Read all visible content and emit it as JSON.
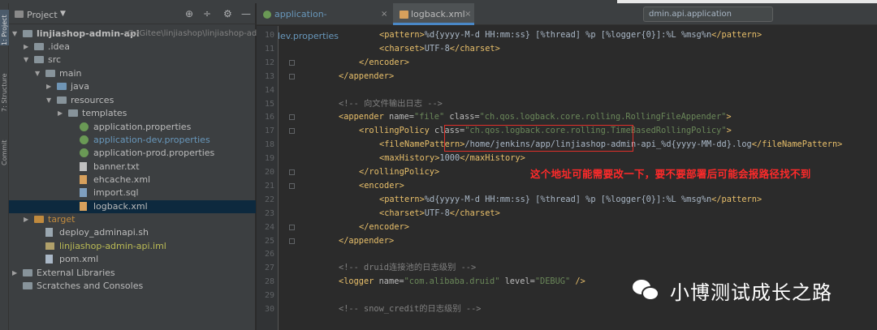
{
  "window": {
    "toolbar_hint": "dmin.api.application"
  },
  "sidebar_strip": {
    "project_label": "1: Project",
    "structure_label": "7: Structure",
    "commit_label": "Commit"
  },
  "project_panel": {
    "title": "Project",
    "tree": [
      {
        "label": "linjiashop-admin-api",
        "path": "G:\\Gitee\\linjiashop\\linjiashop-admi",
        "icon": "module-icon",
        "bold": true,
        "color": "#bbbbbb"
      },
      {
        "label": ".idea",
        "icon": "folder-icon",
        "color": "#bbbbbb"
      },
      {
        "label": "src",
        "icon": "folder-icon",
        "color": "#bbbbbb"
      },
      {
        "label": "main",
        "icon": "folder-icon",
        "color": "#bbbbbb"
      },
      {
        "label": "java",
        "icon": "source-folder-icon",
        "color": "#bbbbbb"
      },
      {
        "label": "resources",
        "icon": "resources-folder-icon",
        "color": "#bbbbbb"
      },
      {
        "label": "templates",
        "icon": "folder-icon",
        "color": "#bbbbbb"
      },
      {
        "label": "application.properties",
        "icon": "spring-properties-icon",
        "color": "#bbbbbb"
      },
      {
        "label": "application-dev.properties",
        "icon": "spring-properties-icon",
        "color": "#6897bb"
      },
      {
        "label": "application-prod.properties",
        "icon": "spring-properties-icon",
        "color": "#bbbbbb"
      },
      {
        "label": "banner.txt",
        "icon": "text-file-icon",
        "color": "#bbbbbb"
      },
      {
        "label": "ehcache.xml",
        "icon": "xml-file-icon",
        "color": "#bbbbbb"
      },
      {
        "label": "import.sql",
        "icon": "sql-file-icon",
        "color": "#bbbbbb"
      },
      {
        "label": "logback.xml",
        "icon": "xml-file-icon",
        "color": "#bbbbbb",
        "selected": true
      },
      {
        "label": "target",
        "icon": "excluded-folder-icon",
        "color": "#c08a3e"
      },
      {
        "label": "deploy_adminapi.sh",
        "icon": "shell-file-icon",
        "color": "#bbbbbb"
      },
      {
        "label": "linjiashop-admin-api.iml",
        "icon": "iml-file-icon",
        "color": "#bbbb55"
      },
      {
        "label": "pom.xml",
        "icon": "maven-icon",
        "color": "#bbbbbb"
      },
      {
        "label": "External Libraries",
        "icon": "library-icon",
        "color": "#bbbbbb"
      },
      {
        "label": "Scratches and Consoles",
        "icon": "scratch-icon",
        "color": "#bbbbbb"
      }
    ]
  },
  "tabs": [
    {
      "label": "application-dev.properties",
      "color": "#6897bb"
    },
    {
      "label": "logback.xml",
      "color": "#bbbbbb",
      "active": true
    }
  ],
  "code": {
    "line_numbers": [
      "10",
      "11",
      "12",
      "13",
      "14",
      "15",
      "16",
      "17",
      "18",
      "19",
      "20",
      "21",
      "22",
      "23",
      "24",
      "25",
      "26",
      "27",
      "28",
      "29",
      "30"
    ],
    "lines": [
      [
        [
          "t-tag",
          "<pattern>"
        ],
        [
          "t-txt",
          "%d{yyyy-M-d HH:mm:ss} [%thread] %p [%logger{0}]:%L %msg%n"
        ],
        [
          "t-tag",
          "</pattern>"
        ]
      ],
      [
        [
          "t-tag",
          "<charset>"
        ],
        [
          "t-txt",
          "UTF-8"
        ],
        [
          "t-tag",
          "</charset>"
        ]
      ],
      [
        [
          "t-tag",
          "</encoder>"
        ]
      ],
      [
        [
          "t-tag",
          "</appender>"
        ]
      ],
      [],
      [
        [
          "t-cmt",
          "<!-- 向文件输出日志 -->"
        ]
      ],
      [
        [
          "t-tag",
          "<appender "
        ],
        [
          "t-attr",
          "name="
        ],
        [
          "t-val",
          "\"file\" "
        ],
        [
          "t-attr",
          "class="
        ],
        [
          "t-val",
          "\"ch.qos.logback.core.rolling.RollingFileAppender\""
        ],
        [
          "t-tag",
          ">"
        ]
      ],
      [
        [
          "t-tag",
          "<rollingPolicy "
        ],
        [
          "t-attr",
          "class="
        ],
        [
          "t-val",
          "\"ch.qos.logback.core.rolling.TimeBasedRollingPolicy\""
        ],
        [
          "t-tag",
          ">"
        ]
      ],
      [
        [
          "t-tag",
          "<fileNamePattern>"
        ],
        [
          "t-txt",
          "/home/jenkins/app/linjiashop-admin-api_%d{yyyy-MM-dd}.log"
        ],
        [
          "t-tag",
          "</fileNamePattern>"
        ]
      ],
      [
        [
          "t-tag",
          "<maxHistory>"
        ],
        [
          "t-txt",
          "1000"
        ],
        [
          "t-tag",
          "</maxHistory>"
        ]
      ],
      [
        [
          "t-tag",
          "</rollingPolicy>"
        ]
      ],
      [
        [
          "t-tag",
          "<encoder>"
        ]
      ],
      [
        [
          "t-tag",
          "<pattern>"
        ],
        [
          "t-txt",
          "%d{yyyy-M-d HH:mm:ss} [%thread] %p [%logger{0}]:%L %msg%n"
        ],
        [
          "t-tag",
          "</pattern>"
        ]
      ],
      [
        [
          "t-tag",
          "<charset>"
        ],
        [
          "t-txt",
          "UTF-8"
        ],
        [
          "t-tag",
          "</charset>"
        ]
      ],
      [
        [
          "t-tag",
          "</encoder>"
        ]
      ],
      [
        [
          "t-tag",
          "</appender>"
        ]
      ],
      [],
      [
        [
          "t-cmt",
          "<!-- druid连接池的日志级别 -->"
        ]
      ],
      [
        [
          "t-tag",
          "<logger "
        ],
        [
          "t-attr",
          "name="
        ],
        [
          "t-val",
          "\"com.alibaba.druid\" "
        ],
        [
          "t-attr",
          "level="
        ],
        [
          "t-val",
          "\"DEBUG\" "
        ],
        [
          "t-tag",
          "/>"
        ]
      ],
      [],
      [
        [
          "t-cmt",
          "<!-- snow_credit的日志级别 -->"
        ]
      ]
    ]
  },
  "annotation": {
    "text": "这个地址可能需要改一下，要不要部署后可能会报路径找不到",
    "color": "#ff2a2a"
  },
  "watermark": {
    "text": "小博测试成长之路"
  }
}
